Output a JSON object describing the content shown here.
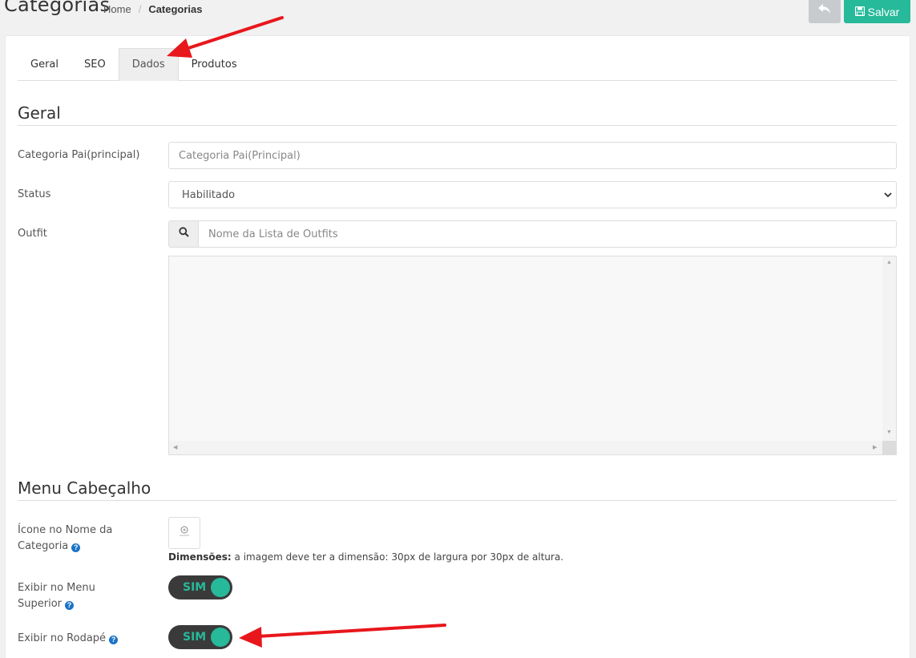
{
  "header": {
    "title": "Categorias",
    "breadcrumb_home": "Home",
    "breadcrumb_sep": "/",
    "breadcrumb_current": "Categorias",
    "save_label": "Salvar"
  },
  "tabs": [
    {
      "label": "Geral",
      "active": false
    },
    {
      "label": "SEO",
      "active": false
    },
    {
      "label": "Dados",
      "active": true
    },
    {
      "label": "Produtos",
      "active": false
    }
  ],
  "sections": {
    "geral": "Geral",
    "menu": "Menu Cabeçalho"
  },
  "form": {
    "parent_label": "Categoria Pai(principal)",
    "parent_placeholder": "Categoria Pai(Principal)",
    "status_label": "Status",
    "status_value": "Habilitado",
    "outfit_label": "Outfit",
    "outfit_placeholder": "Nome da Lista de Outfits",
    "icon_label_line1": "Ícone no Nome da",
    "icon_label_line2": "Categoria",
    "dimensions_bold": "Dimensões:",
    "dimensions_text": " a imagem deve ter a dimensão: 30px de largura por 30px de altura.",
    "menu_top_label_line1": "Exibir no Menu",
    "menu_top_label_line2": "Superior",
    "menu_top_toggle": "SIM",
    "footer_label": "Exibir no Rodapé",
    "footer_toggle": "SIM",
    "help_glyph": "?"
  },
  "colors": {
    "accent": "#26b99a",
    "back_button": "#c8cbce",
    "toggle_bg": "#3a3a3a",
    "annotation": "#e8171c"
  },
  "icons": {
    "back": "reply-icon",
    "save": "floppy-disk-icon",
    "search": "search-icon",
    "select": "chevron-down-icon"
  }
}
